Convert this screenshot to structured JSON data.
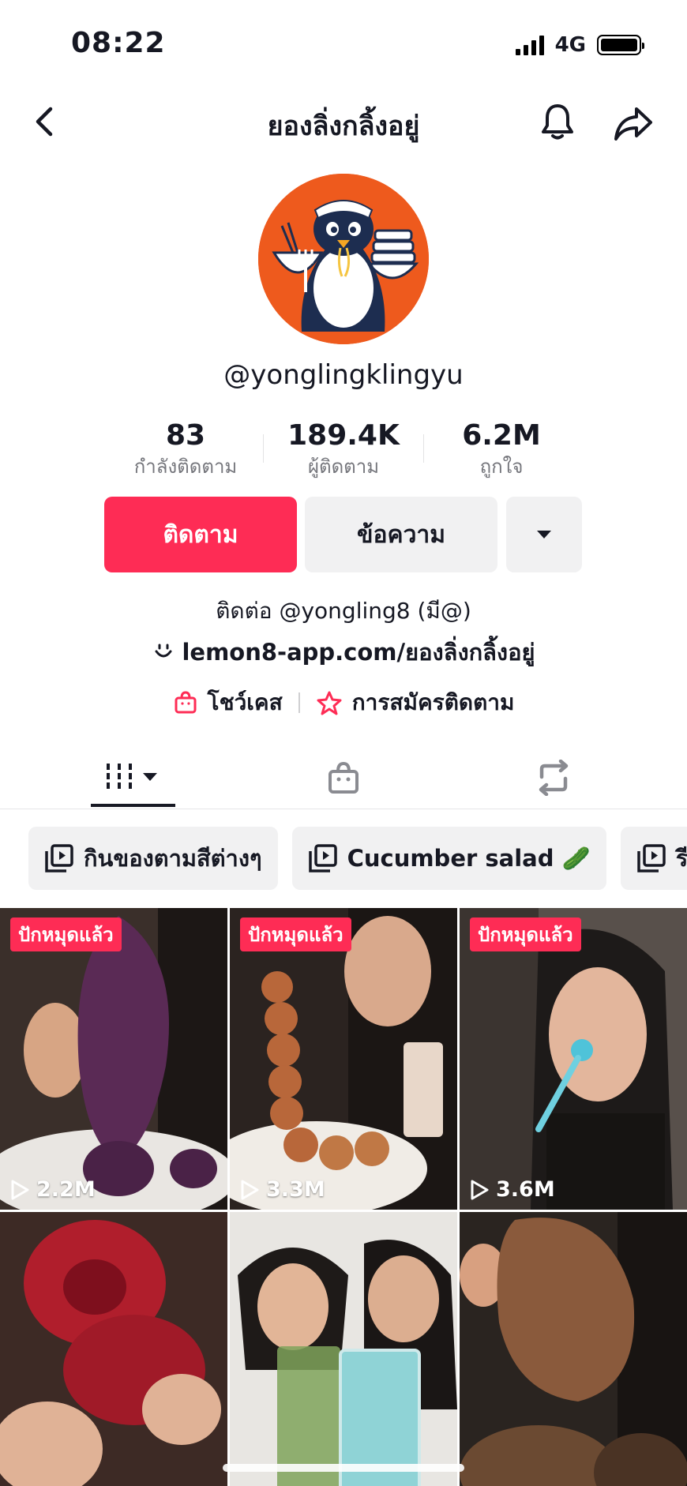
{
  "status_bar": {
    "time": "08:22",
    "network": "4G"
  },
  "header": {
    "title": "ยองลิ่งกลิ้งอยู่"
  },
  "profile": {
    "username": "@yonglingklingyu"
  },
  "stats": [
    {
      "value": "83",
      "label": "กำลังติดตาม"
    },
    {
      "value": "189.4K",
      "label": "ผู้ติดตาม"
    },
    {
      "value": "6.2M",
      "label": "ถูกใจ"
    }
  ],
  "actions": {
    "follow": "ติดตาม",
    "message": "ข้อความ"
  },
  "bio": {
    "contact": "ติดต่อ @yongling8 (มี@)",
    "link": "lemon8-app.com/ยองลิ่งกลิ้งอยู่",
    "showcase": "โชว์เคส",
    "subscription": "การสมัครติดตาม"
  },
  "playlists": [
    {
      "label": "กินของตามสีต่างๆ"
    },
    {
      "label": "Cucumber salad 🥒"
    },
    {
      "label": "รีวิ"
    }
  ],
  "videos": [
    {
      "pinned": "ปักหมุดแล้ว",
      "views": "2.2M"
    },
    {
      "pinned": "ปักหมุดแล้ว",
      "views": "3.3M"
    },
    {
      "pinned": "ปักหมุดแล้ว",
      "views": "3.6M"
    },
    {
      "pinned": "",
      "views": ""
    },
    {
      "pinned": "",
      "views": ""
    },
    {
      "pinned": "",
      "views": ""
    }
  ],
  "colors": {
    "accent": "#fe2c55",
    "avatar_bg": "#ee5a1d"
  }
}
